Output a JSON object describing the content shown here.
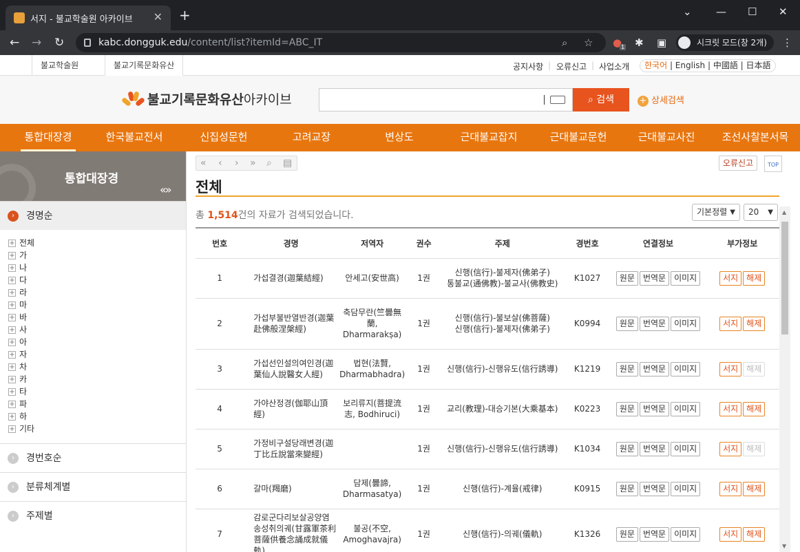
{
  "browser": {
    "tab_title": "서지 - 불교학술원 아카이브",
    "url_domain": "kabc.dongguk.edu",
    "url_path": "/content/list?itemId=ABC_IT",
    "profile_label": "시크릿 모드(창 2개)",
    "ext_badge": "1"
  },
  "site": {
    "tabs": [
      "불교학술원",
      "불교기록문화유산"
    ],
    "top_links": [
      "공지사항",
      "오류신고",
      "사업소개"
    ],
    "langs": [
      "한국어",
      "English",
      "中國語",
      "日本語"
    ],
    "logo": "불교기록문화유산",
    "logo_suffix": "아카이브",
    "search_button": "검색",
    "advanced_search": "상세검색"
  },
  "gnb": [
    "통합대장경",
    "한국불교전서",
    "신집성문헌",
    "고려교장",
    "변상도",
    "근대불교잡지",
    "근대불교문헌",
    "근대불교사진",
    "조선사찰본서목"
  ],
  "lnb": {
    "title": "통합대장경",
    "arrows": "«»",
    "sections": [
      "경명순",
      "경번호순",
      "분류체계별",
      "주제별"
    ],
    "tree": [
      "전체",
      "가",
      "나",
      "다",
      "라",
      "마",
      "바",
      "사",
      "아",
      "자",
      "차",
      "카",
      "타",
      "파",
      "하",
      "기타"
    ]
  },
  "content": {
    "title": "전체",
    "error_button": "오류신고",
    "top_button": "TOP",
    "count_prefix": "총 ",
    "count_value": "1,514",
    "count_suffix": "건의 자료가 검색되었습니다.",
    "sort_select": "기본정렬",
    "size_select": "20",
    "headers": [
      "번호",
      "경명",
      "저역자",
      "권수",
      "주제",
      "경번호",
      "연결정보",
      "부가정보"
    ],
    "link_buttons": [
      "원문",
      "번역문",
      "이미지"
    ],
    "extra_buttons": [
      "서지",
      "해제"
    ],
    "rows": [
      {
        "no": "1",
        "title": "가섭결경(迦葉結經)",
        "author": "안세고(安世高)",
        "vol": "1권",
        "topic": "신행(信行)-불제자(佛弟子)\n통불교(通佛教)-불교사(佛教史)",
        "code": "K1027",
        "haeje": true
      },
      {
        "no": "2",
        "title": "가섭부불반열반경(迦葉赴佛般涅槃經)",
        "author": "축담무란(竺曇無蘭, Dharmarakṣa)",
        "vol": "1권",
        "topic": "신행(信行)-불보살(佛菩薩)\n신행(信行)-불제자(佛弟子)",
        "code": "K0994",
        "haeje": true
      },
      {
        "no": "3",
        "title": "가섭선인설의여인경(迦葉仙人說醫女人經)",
        "author": "법현(法賢, Dharmabhadra)",
        "vol": "1권",
        "topic": "신행(信行)-신행유도(信行誘導)",
        "code": "K1219",
        "haeje": false
      },
      {
        "no": "4",
        "title": "가야산정경(伽耶山頂經)",
        "author": "보리류지(菩提流志, Bodhiruci)",
        "vol": "1권",
        "topic": "교리(教理)-대승기본(大乘基本)",
        "code": "K0223",
        "haeje": true
      },
      {
        "no": "5",
        "title": "가정비구설당래변경(迦丁比丘說當來變經)",
        "author": "",
        "vol": "1권",
        "topic": "신행(信行)-신행유도(信行誘導)",
        "code": "K1034",
        "haeje": false
      },
      {
        "no": "6",
        "title": "갈마(羯磨)",
        "author": "담제(曇諦, Dharmasatya)",
        "vol": "1권",
        "topic": "신행(信行)-계율(戒律)",
        "code": "K0915",
        "haeje": true
      },
      {
        "no": "7",
        "title": "감로군다리보살공양염송성취의궤(甘露軍茶利菩薩供養念誦成就儀軌)",
        "author": "불공(不空, Amoghavajra)",
        "vol": "1권",
        "topic": "신행(信行)-의궤(儀軌)",
        "code": "K1326",
        "haeje": true
      }
    ]
  },
  "colors": {
    "accent": "#e8760f",
    "search": "#e8541e",
    "highlight": "#e0531a"
  }
}
